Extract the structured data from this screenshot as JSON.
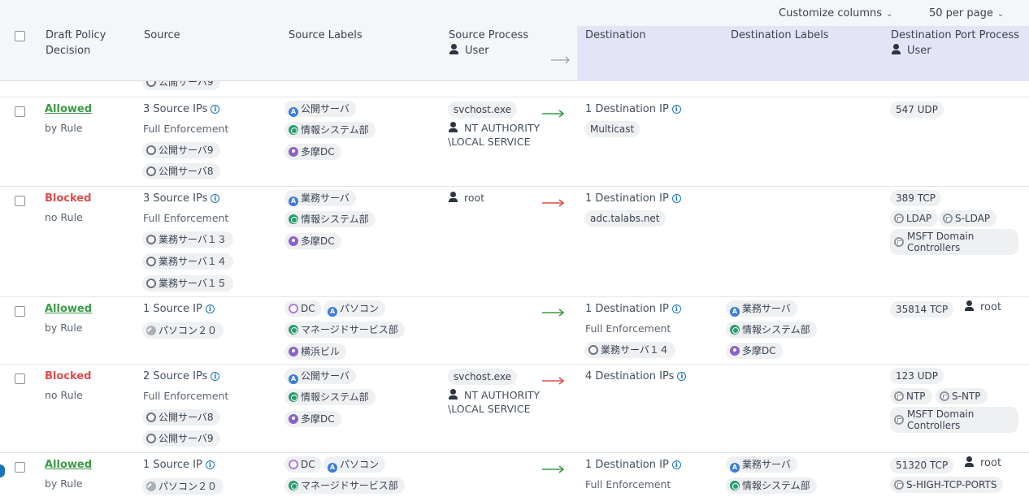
{
  "toolbar": {
    "customize_columns": "Customize columns",
    "per_page": "50 per page"
  },
  "columns": {
    "decision": "Draft Policy\nDecision",
    "source": "Source",
    "source_labels": "Source Labels",
    "source_process": "Source Process",
    "source_user": "User",
    "destination": "Destination",
    "destination_labels": "Destination Labels",
    "destination_port_process": "Destination Port Process",
    "destination_user": "User"
  },
  "peek_row": {
    "workload": "公開サーバ9"
  },
  "colors": {
    "allowed": "#3b9b45",
    "blocked": "#e14b4b",
    "destination_header_bg": "#e4e4f7",
    "info_icon": "#1b73b9"
  },
  "rows": [
    {
      "decision": "Allowed",
      "decision_sub": "by Rule",
      "arrow": "green",
      "source_count": "3 Source IPs",
      "source_enforcement": "Full Enforcement",
      "source_workloads": [
        "公開サーバ9",
        "公開サーバ8"
      ],
      "source_labels": [
        {
          "icon": "role-icon",
          "text": "公開サーバ"
        },
        {
          "icon": "app-icon",
          "text": "情報システム部"
        },
        {
          "icon": "location-icon",
          "text": "多摩DC"
        }
      ],
      "process": "svchost.exe",
      "user": "NT AUTHORITY\\LOCAL SERVICE",
      "dest_count": "1 Destination IP",
      "dest_tag": "Multicast",
      "port": "547 UDP"
    },
    {
      "decision": "Blocked",
      "decision_sub": "no Rule",
      "arrow": "red",
      "source_count": "3 Source IPs",
      "source_enforcement": "Full Enforcement",
      "source_workloads": [
        "業務サーバ１３",
        "業務サーバ１４",
        "業務サーバ１５"
      ],
      "source_labels": [
        {
          "icon": "role-icon",
          "text": "業務サーバ"
        },
        {
          "icon": "app-icon",
          "text": "情報システム部"
        },
        {
          "icon": "location-icon",
          "text": "多摩DC"
        }
      ],
      "user": "root",
      "dest_count": "1 Destination IP",
      "dest_tag": "adc.talabs.net",
      "port": "389 TCP",
      "services": [
        "LDAP",
        "S-LDAP"
      ],
      "service_multi": "MSFT Domain Controllers"
    },
    {
      "decision": "Allowed",
      "decision_sub": "by Rule",
      "arrow": "green",
      "source_count": "1 Source IP",
      "source_workloads": [
        "パソコン２０"
      ],
      "source_labels": [
        {
          "icon": "env-icon",
          "text": "DC"
        },
        {
          "icon": "role-icon",
          "text": "パソコン"
        },
        {
          "icon": "app-icon",
          "text": "マネージドサービス部"
        },
        {
          "icon": "location-icon",
          "text": "横浜ビル"
        }
      ],
      "dest_count": "1 Destination IP",
      "dest_enforcement": "Full Enforcement",
      "dest_workload": "業務サーバ１４",
      "dest_labels": [
        {
          "icon": "role-icon",
          "text": "業務サーバ"
        },
        {
          "icon": "app-icon",
          "text": "情報システム部"
        },
        {
          "icon": "location-icon",
          "text": "多摩DC"
        }
      ],
      "port": "35814 TCP",
      "dest_user": "root"
    },
    {
      "decision": "Blocked",
      "decision_sub": "no Rule",
      "arrow": "red",
      "source_count": "2 Source IPs",
      "source_enforcement": "Full Enforcement",
      "source_workloads": [
        "公開サーバ8",
        "公開サーバ9"
      ],
      "source_labels": [
        {
          "icon": "role-icon",
          "text": "公開サーバ"
        },
        {
          "icon": "app-icon",
          "text": "情報システム部"
        },
        {
          "icon": "location-icon",
          "text": "多摩DC"
        }
      ],
      "process": "svchost.exe",
      "user": "NT AUTHORITY\\LOCAL SERVICE",
      "dest_count": "4 Destination IPs",
      "port": "123 UDP",
      "services": [
        "NTP",
        "S-NTP"
      ],
      "service_multi": "MSFT Domain Controllers"
    },
    {
      "decision": "Allowed",
      "decision_sub": "by Rule",
      "arrow": "green",
      "source_count": "1 Source IP",
      "source_workloads": [
        "パソコン２０"
      ],
      "source_labels": [
        {
          "icon": "env-icon",
          "text": "DC"
        },
        {
          "icon": "role-icon",
          "text": "パソコン"
        },
        {
          "icon": "app-icon",
          "text": "マネージドサービス部"
        }
      ],
      "dest_count": "1 Destination IP",
      "dest_enforcement": "Full Enforcement",
      "dest_labels": [
        {
          "icon": "role-icon",
          "text": "業務サーバ"
        },
        {
          "icon": "app-icon",
          "text": "情報システム部"
        }
      ],
      "port": "51320 TCP",
      "dest_user": "root",
      "services": [
        "S-HIGH-TCP-PORTS"
      ]
    }
  ]
}
